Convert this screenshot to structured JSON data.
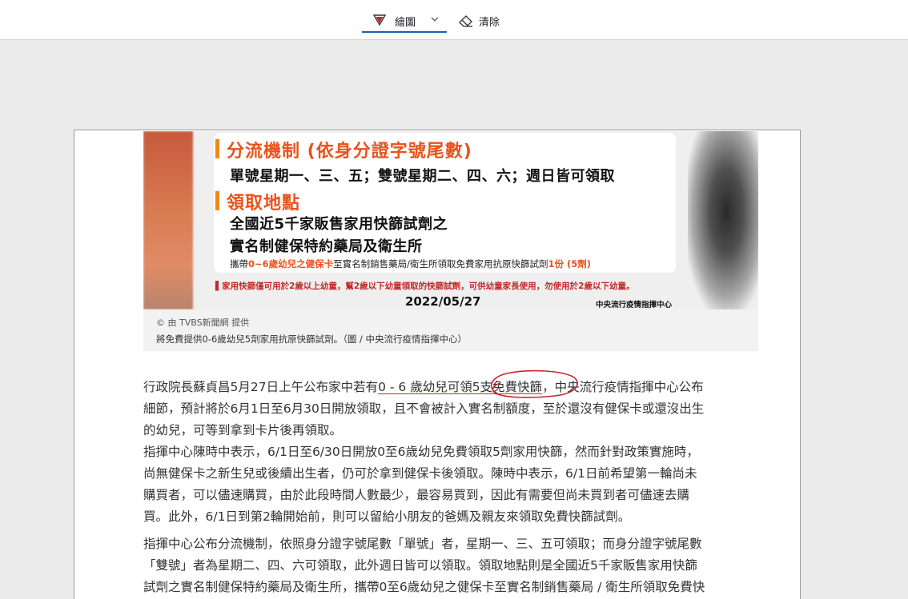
{
  "toolbar": {
    "draw_label": "繪圖",
    "clear_label": "清除",
    "accent": "#1c5fae"
  },
  "figure": {
    "poster": {
      "section1_title": "分流機制 (依身分證字號尾數)",
      "section1_text": "單號星期一、三、五；雙號星期二、四、六；週日皆可領取",
      "section2_title": "領取地點",
      "section2_line1": "全國近5千家販售家用快篩試劑之",
      "section2_line2": "實名制健保特約藥局及衛生所",
      "fine_a": "攜帶",
      "fine_hl1": "0~6歲幼兒之健保卡",
      "fine_b": "至實名制銷售藥局/衛生所領取免費家用抗原快篩試劑",
      "fine_hl2": "1份 (5劑)",
      "warning": "▌家用快篩僅可用於2歲以上幼童，幫2歲以下幼童領取的快篩試劑，可供幼童家長使用，勿使用於2歲以下幼童。",
      "date": "2022/05/27",
      "org": "中央流行疫情指揮中心"
    },
    "credit": "© 由 TVBS新聞網 提供",
    "caption": "將免費提供0-6歲幼兒5劑家用抗原快篩試劑。（圖 / 中央流行疫情指揮中心）"
  },
  "article": {
    "p1_l1_a": "行政院長蘇貞昌5月27日上午公布家中若有",
    "p1_l1_u": "0 - 6 歲幼兒可領5支免費快篩",
    "p1_l1_b": "，中央流行疫情指揮中心公布",
    "p1_l2": "細節，預計將於6月1日至6月30日開放領取，且不會被計入實名制額度，至於還沒有健保卡或還沒出生",
    "p1_l3": "的幼兒，可等到拿到卡片後再領取。",
    "p2_l1": "指揮中心陳時中表示，6/1日至6/30日開放0至6歲幼兒免費領取5劑家用快篩，然而針對政策實施時，",
    "p2_l2": "尚無健保卡之新生兒或後續出生者，仍可於拿到健保卡後領取。陳時中表示，6/1日前希望第一輪尚未",
    "p2_l3": "購買者，可以儘速購買，由於此段時間人數最少，最容易買到，因此有需要但尚未買到者可儘速去購",
    "p2_l4": "買。此外，6/1日到第2輪開始前，則可以留給小朋友的爸媽及親友來領取免費快篩試劑。",
    "p3_l1": "指揮中心公布分流機制，依照身分證字號尾數「單號」者，星期一、三、五可領取；而身分證字號尾數",
    "p3_l2": "「雙號」者為星期二、四、六可領取，此外週日皆可以領取。領取地點則是全國近5千家販售家用快篩",
    "p3_l3": "試劑之實名制健保特約藥局及衛生所，攜帶0至6歲幼兒之健保卡至實名制銷售藥局 / 衛生所領取免費快"
  },
  "annotation_color": "#c0282f"
}
